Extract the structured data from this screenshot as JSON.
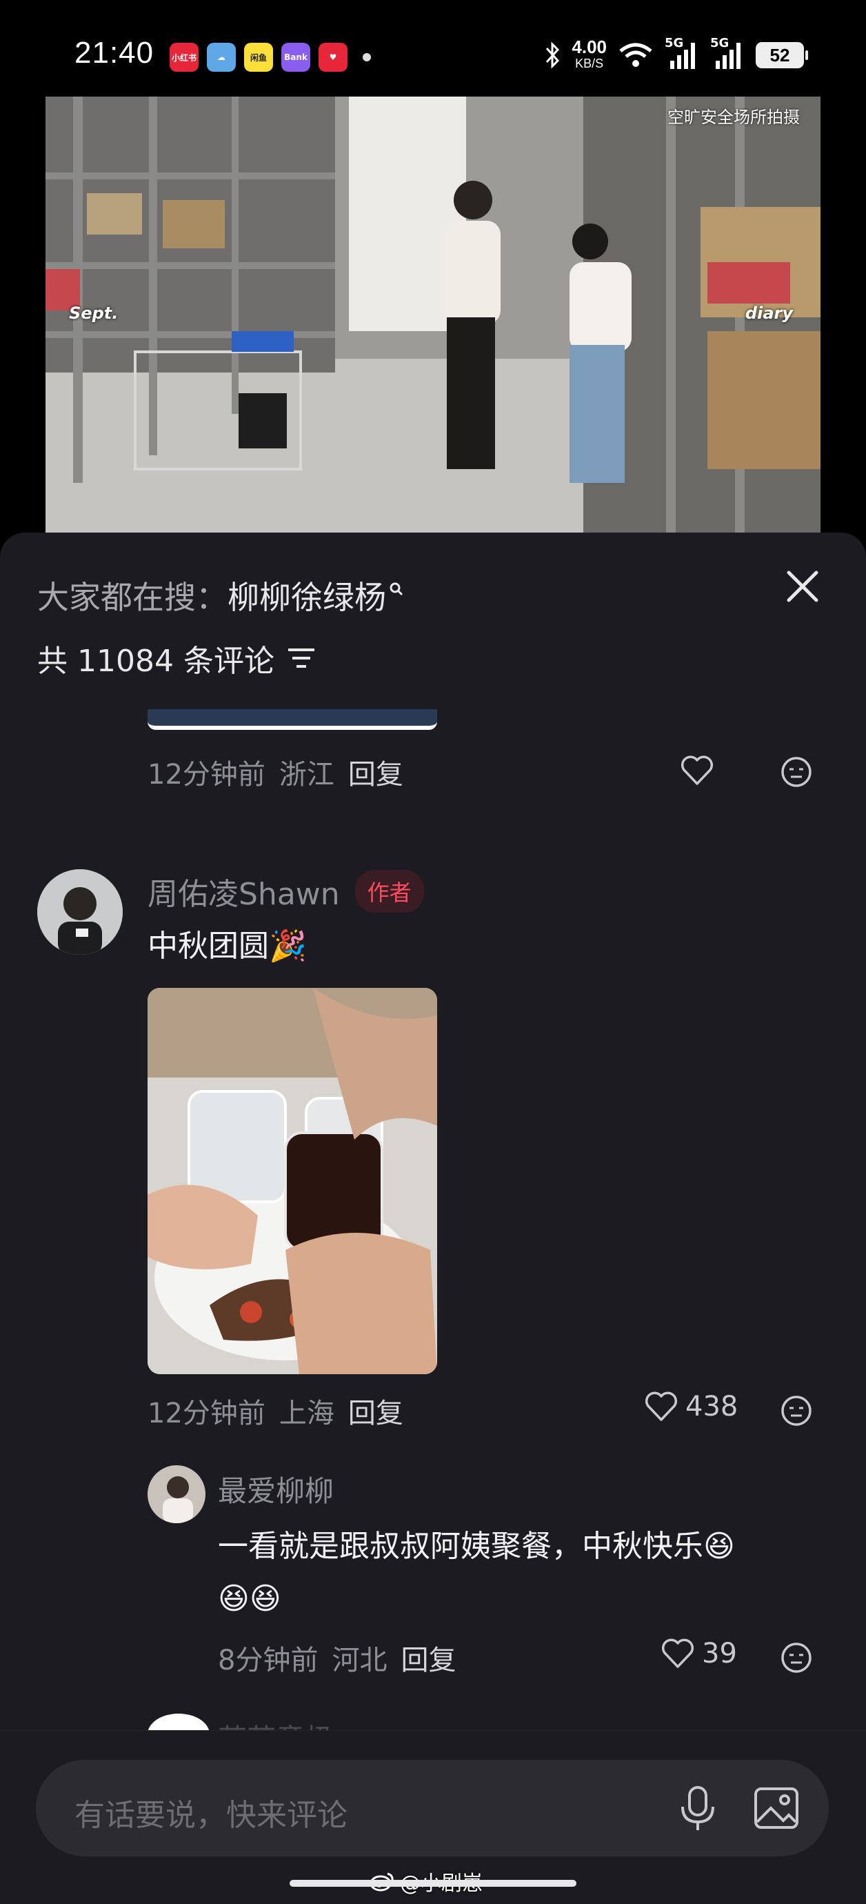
{
  "status_bar": {
    "time": "21:40",
    "apps": [
      {
        "label": "小红书",
        "color": "#e8263a"
      },
      {
        "label": "☁",
        "color": "#5fa8e8"
      },
      {
        "label": "闲鱼",
        "color": "#ffe03a"
      },
      {
        "label": "Bank",
        "color": "#8a5cf0"
      },
      {
        "label": "♥",
        "color": "#e8263a"
      }
    ],
    "net_speed": "4.00",
    "net_unit": "KB/S",
    "signal_1": "5G",
    "signal_2": "5G",
    "battery": "52"
  },
  "video": {
    "top_caption": "空旷安全场所拍摄",
    "left_tag": "Sept.",
    "right_tag": "diary"
  },
  "comments_panel": {
    "search_prefix": "大家都在搜：",
    "search_term": "柳柳徐绿杨",
    "count_label": "共 11084 条评论",
    "close_icon": "close-icon",
    "filter_icon": "filter-icon"
  },
  "previous_comment": {
    "time": "12分钟前",
    "location": "浙江",
    "reply_label": "回复"
  },
  "author_comment": {
    "username": "周佑凌Shawn",
    "badge": "作者",
    "text": "中秋团圆🎉",
    "time": "12分钟前",
    "location": "上海",
    "reply_label": "回复",
    "likes": "438"
  },
  "sub_comment": {
    "username": "最爱柳柳",
    "text_line1": "一看就是跟叔叔阿姨聚餐，中秋快乐😆",
    "text_line2": "😆😆",
    "time": "8分钟前",
    "location": "河北",
    "reply_label": "回复",
    "likes": "39"
  },
  "next_comment_peek": {
    "username": "若若意极"
  },
  "input_bar": {
    "placeholder": "有话要说，快来评论",
    "watermark": "@小剧崽"
  }
}
